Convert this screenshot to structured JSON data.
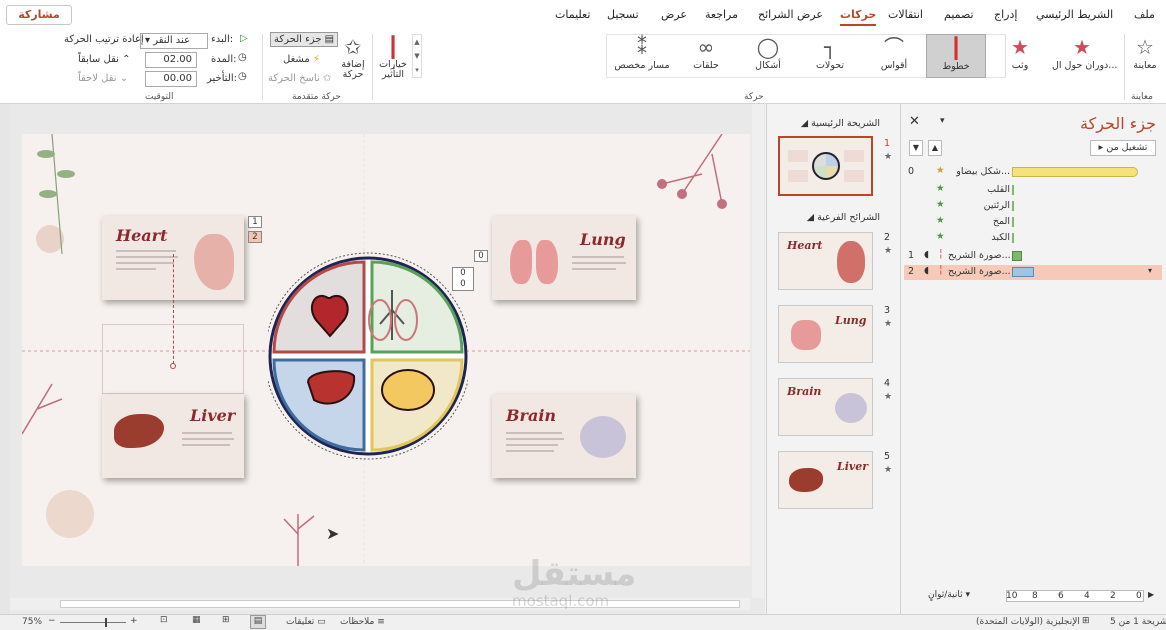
{
  "window": {
    "share_label": "مشاركة"
  },
  "tabs": [
    "ملف",
    "الشريط الرئيسي",
    "إدراج",
    "تصميم",
    "انتقالات",
    "حركات",
    "عرض الشرائح",
    "مراجعة",
    "عرض",
    "تسجيل",
    "تعليمات"
  ],
  "active_tab": "حركات",
  "ribbon": {
    "preview_label": "معاينة",
    "preview_group": "معاينة",
    "animation_group": "حركة",
    "effects": [
      "دوران حول ال...",
      "وثب",
      "خطوط",
      "أقواس",
      "تحولات",
      "أشكال",
      "حلقات",
      "مسار مخصص"
    ],
    "selected_effect": "خطوط",
    "effect_options": "خيارات التأثير",
    "add_animation": "إضافة حركة",
    "animation_pane_btn": "جزء الحركة",
    "trigger": "مشغل",
    "painter": "ناسخ الحركة",
    "advanced_group": "حركة متقدمة",
    "start_label": "البدء:",
    "start_value": "عند النقر",
    "duration_label": "المدة:",
    "duration_value": "02.00",
    "delay_label": "التأخير:",
    "delay_value": "00.00",
    "reorder_label": "إعادة ترتيب الحركة",
    "move_earlier": "نقل سابقاً",
    "move_later": "نقل لاحقاً",
    "timing_group": "التوقيت"
  },
  "slide": {
    "cards": {
      "heart": "Heart",
      "lung": "Lung",
      "liver": "Liver",
      "brain": "Brain"
    },
    "tags": [
      "1",
      "2",
      "0",
      "0",
      "0"
    ]
  },
  "thumbnails": {
    "main_section": "الشريحة الرئيسية",
    "sub_section": "الشرائح الفرعية",
    "items": [
      {
        "num": "1",
        "title": ""
      },
      {
        "num": "2",
        "title": "Heart"
      },
      {
        "num": "3",
        "title": "Lung"
      },
      {
        "num": "4",
        "title": "Brain"
      },
      {
        "num": "5",
        "title": "Liver"
      }
    ]
  },
  "animation_pane": {
    "title": "جزء الحركة",
    "play_from": "تشغيل من",
    "items": [
      {
        "num": "0",
        "label": "شكل بيضاو...",
        "color": "#f5e27a"
      },
      {
        "num": "",
        "label": "القلب",
        "color": "#7fb86a"
      },
      {
        "num": "",
        "label": "الرئتين",
        "color": "#7fb86a"
      },
      {
        "num": "",
        "label": "المخ",
        "color": "#7fb86a"
      },
      {
        "num": "",
        "label": "الكبد",
        "color": "#7fb86a"
      },
      {
        "num": "1",
        "label": "صورة الشريح...",
        "color": "#7fb86a"
      },
      {
        "num": "2",
        "label": "صورة الشريح...",
        "color": "#9fc5e0"
      }
    ],
    "seconds_label": "ثانية/ثوانٍ",
    "timeline": [
      "0",
      "2",
      "4",
      "6",
      "8",
      "10"
    ]
  },
  "status": {
    "slide_info": "شريحة 1 من 5",
    "language": "الإنجليزية (الولايات المتحدة)",
    "notes": "ملاحظات",
    "comments": "تعليقات",
    "zoom": "75%"
  },
  "watermark": {
    "ar": "مستقل",
    "en": "mostaql.com"
  },
  "colors": {
    "accent": "#b7472a",
    "card_title": "#8b2a2e"
  }
}
